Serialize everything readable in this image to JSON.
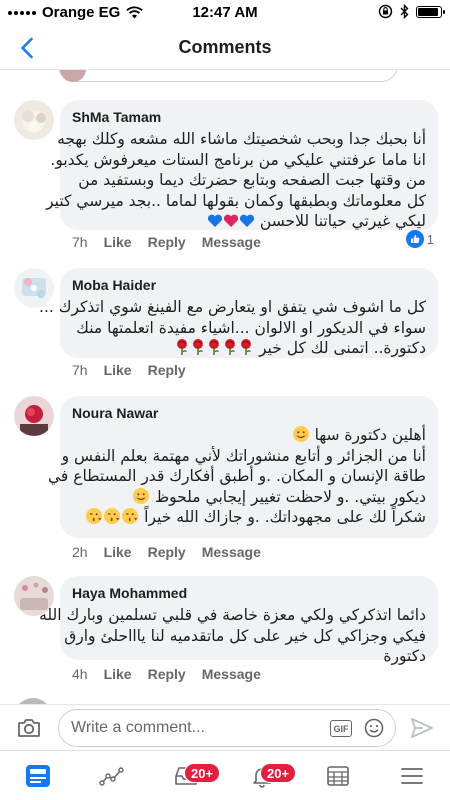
{
  "status_bar": {
    "carrier": "Orange EG",
    "time": "12:47 AM",
    "battery_level": 0.9
  },
  "header": {
    "title": "Comments",
    "back_icon": "chevron-left-icon"
  },
  "comments": [
    {
      "author": "ShMa Tamam",
      "lines": [
        "أنا بحبك جدا وبحب شخصيتك ماشاء الله مشعه وكلك بهجه",
        "انا ماما عرفتني عليكي من برنامج الستات ميعرفوش يكدبو.",
        "من وقتها جبت الصفحه وبتابع حضرتك ديما وبستفيد من",
        "كل معلوماتك وبطبقها وكمان بقولها لماما ..بجد ميرسي كتير",
        "ليكي غيرتي حياتنا للاحسن"
      ],
      "trailing_emoji": [
        "blue-heart",
        "red-heart",
        "blue-heart"
      ],
      "time": "7h",
      "like_label": "Like",
      "reply_label": "Reply",
      "message_label": "Message",
      "reaction_count": "1"
    },
    {
      "author": "Moba Haider",
      "lines": [
        "كل ما اشوف شي يتفق او يتعارض مع الفينغ شوي اتذكرك ...",
        "سواء في الديكور او الالوان ...اشياء مفيدة اتعلمتها منك",
        "دكتورة.. اتمنى لك كل خير"
      ],
      "trailing_emoji": [
        "rose",
        "rose",
        "rose",
        "rose",
        "rose"
      ],
      "time": "7h",
      "like_label": "Like",
      "reply_label": "Reply"
    },
    {
      "author": "Noura Nawar",
      "lines": [
        "أهلين دكتورة سها",
        "أنا من الجزائر و أتابع منشوراتك لأني مهتمة بعلم النفس و",
        "طاقة الإنسان و المكان. .و أطبق أفكارك قدر المستطاع في",
        "ديكور بيتي. .و لاحظت تغيير إيجابي ملحوظ",
        "شكراً لك على مجهوداتك. .و جازاك الله خيراً"
      ],
      "time": "2h",
      "like_label": "Like",
      "reply_label": "Reply",
      "message_label": "Message"
    },
    {
      "author": "Haya Mohammed",
      "lines": [
        "دائما اتذكركي ولكي معزة خاصة في قلبي تسلمين وبارك الله",
        "فيكي وجزاكي كل خير على كل ماتقدميه لنا ياااحلئ وارق",
        "دكتورة"
      ],
      "time": "4h",
      "like_label": "Like",
      "reply_label": "Reply",
      "message_label": "Message"
    }
  ],
  "composer": {
    "placeholder": "Write a comment...",
    "gif_label": "GIF"
  },
  "tabbar": {
    "notif_badge_1": "20+",
    "notif_badge_2": "20+"
  },
  "colors": {
    "accent": "#1877f2",
    "badge": "#e41e3f",
    "bubble": "#f0f2f5",
    "meta_text": "#65676b"
  }
}
